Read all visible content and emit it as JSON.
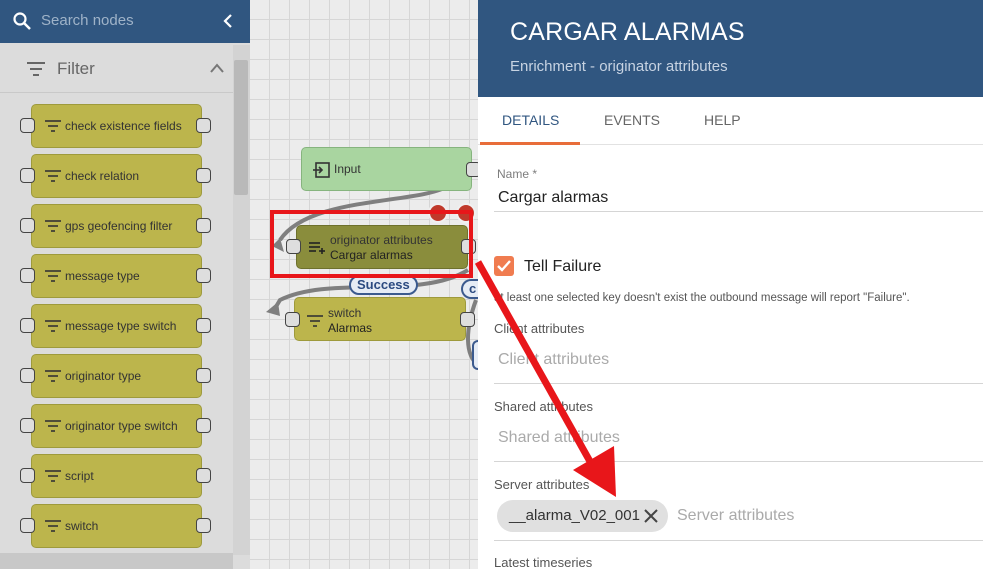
{
  "library": {
    "search_placeholder": "Search nodes",
    "filter_label": "Filter",
    "nodes": [
      {
        "label": "check existence fields"
      },
      {
        "label": "check relation"
      },
      {
        "label": "gps geofencing filter"
      },
      {
        "label": "message type"
      },
      {
        "label": "message type switch"
      },
      {
        "label": "originator type"
      },
      {
        "label": "originator type switch"
      },
      {
        "label": "script"
      },
      {
        "label": "switch"
      }
    ]
  },
  "canvas": {
    "input_node": {
      "label": "Input"
    },
    "selected_node": {
      "type": "originator attributes",
      "name": "Cargar alarmas"
    },
    "switch_node": {
      "type": "switch",
      "name": "Alarmas"
    },
    "edge_success": "Success",
    "edge_partial": "c"
  },
  "detail": {
    "title": "CARGAR ALARMAS",
    "subtitle": "Enrichment - originator attributes",
    "tabs": [
      "DETAILS",
      "EVENTS",
      "HELP"
    ],
    "name_label": "Name *",
    "name_value": "Cargar alarmas",
    "tell_failure_label": "Tell Failure",
    "tell_failure_checked": true,
    "hint": "at least one selected key doesn't exist the outbound message will report \"Failure\".",
    "client_label": "Client attributes",
    "client_placeholder": "Client attributes",
    "shared_label": "Shared attributes",
    "shared_placeholder": "Shared attributes",
    "server_label": "Server attributes",
    "server_chip": "__alarma_V02_001",
    "server_placeholder": "Server attributes",
    "latest_label": "Latest timeseries"
  },
  "colors": {
    "header_blue": "#305680",
    "accent_orange": "#f07c50",
    "filter_node": "#bcb54c",
    "annotation_red": "#e8161a"
  }
}
